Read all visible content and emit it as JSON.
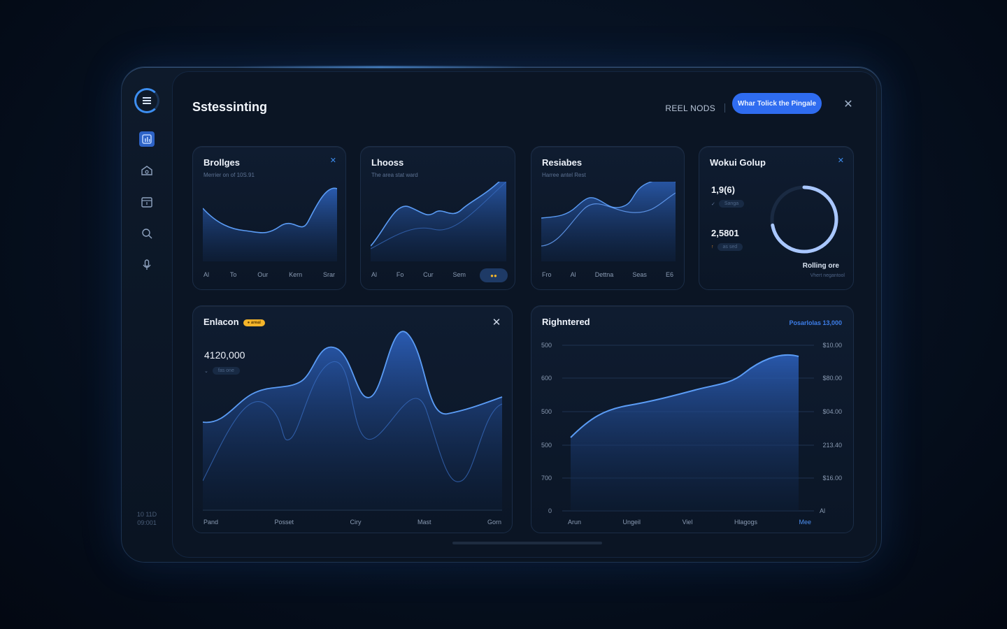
{
  "app": {
    "title": "Sstessinting",
    "top_link": "REEL NODS",
    "cta_label": "Whar Tolick the Pingale",
    "sidebar_footer": [
      "10 11D",
      "09:001"
    ]
  },
  "sidebar": {
    "items": [
      {
        "icon": "bar-chart-icon",
        "active": true
      },
      {
        "icon": "home-icon",
        "active": false
      },
      {
        "icon": "calendar-icon",
        "active": false
      },
      {
        "icon": "search-icon",
        "active": false
      },
      {
        "icon": "microphone-icon",
        "active": false
      }
    ]
  },
  "cards": {
    "card1": {
      "title": "Brollges",
      "subtitle": "Merrier on of 10S.91",
      "xlabels": [
        "Al",
        "To",
        "Our",
        "Kern",
        "Srar"
      ]
    },
    "card2": {
      "title": "Lhooss",
      "subtitle": "The area stat ward",
      "xlabels": [
        "Al",
        "Fo",
        "Cur",
        "Sem"
      ],
      "badge": "●●"
    },
    "card3": {
      "title": "Resiabes",
      "subtitle": "Harree antel Rest",
      "xlabels": [
        "Fro",
        "Al",
        "Dettna",
        "Seas",
        "E6"
      ]
    },
    "card4": {
      "title": "Wokui Golup",
      "stat1": "1,9(6)",
      "stat1_chip": "Sanga",
      "stat1_prefix": "✓",
      "stat2": "2,5801",
      "stat2_chip": "as sed",
      "stat2_prefix": "↑",
      "donut_fraction": 0.72,
      "caption": "Rolling ore",
      "caption_sub": "Vhert negantool"
    },
    "card5": {
      "title": "Enlacon",
      "badge": "● areal",
      "value": "4120,000",
      "chip": "fas one",
      "xlabels": [
        "Pand",
        "Posset",
        "Ciry",
        "Mast",
        "Gorn"
      ]
    },
    "card6": {
      "title": "Righntered",
      "legend": "Posarlolas 13,000",
      "ylabels_left": [
        "500",
        "600",
        "500",
        "500",
        "700",
        "0"
      ],
      "ylabels_right": [
        "$10.00",
        "$80.00",
        "$04.00",
        "213.40",
        "$16.00",
        "Al"
      ],
      "xlabels": [
        "Arun",
        "Ungeil",
        "Viel",
        "Hlagogs",
        "Mee"
      ]
    }
  },
  "colors": {
    "accent": "#2f6cf0",
    "area": "#2a5fb8",
    "line": "#4d8ff0",
    "badge": "#f5b52a"
  }
}
